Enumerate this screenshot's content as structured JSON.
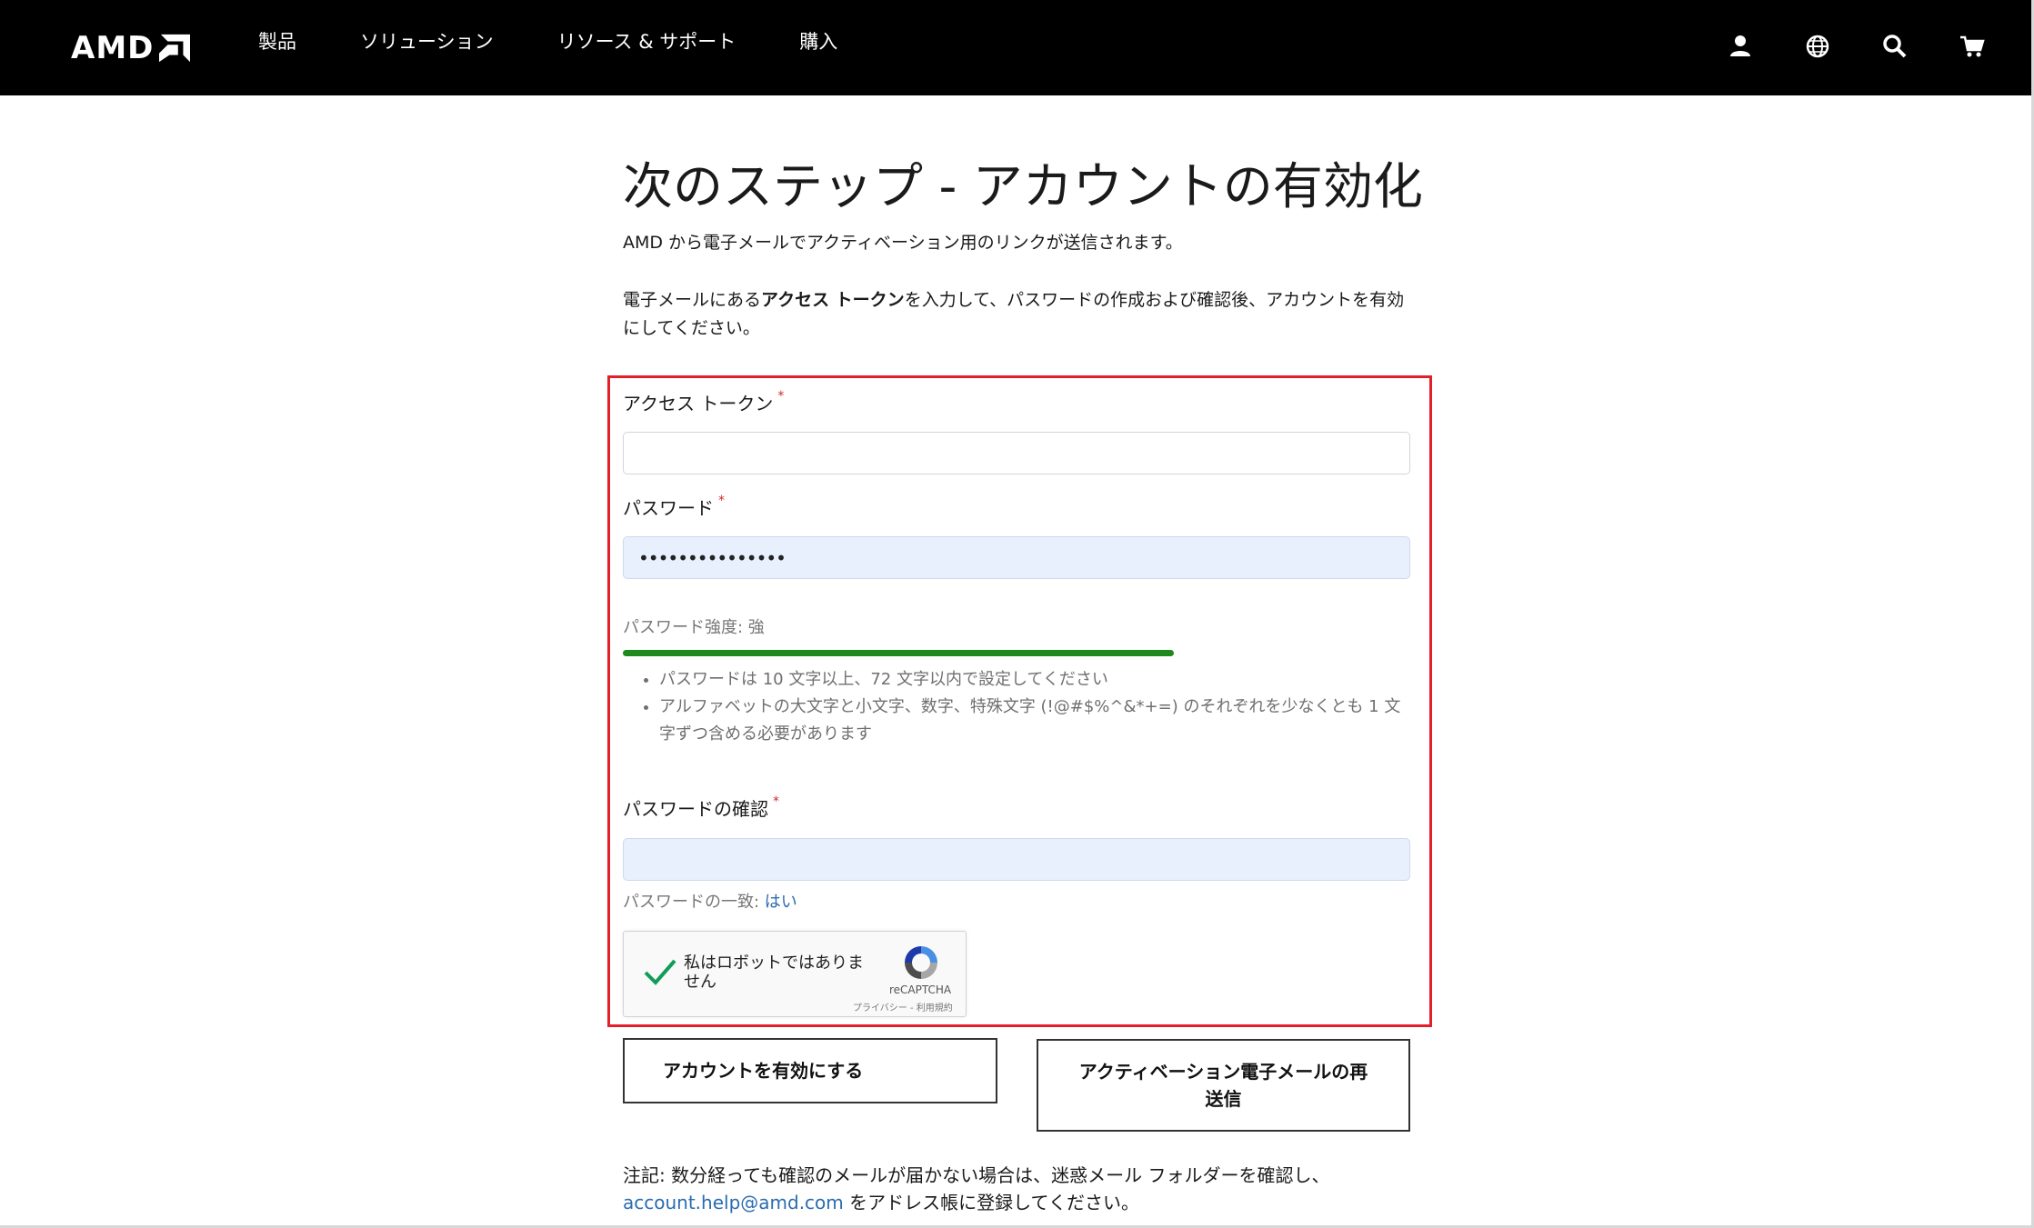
{
  "header": {
    "logo_text": "AMD",
    "nav": [
      "製品",
      "ソリューション",
      "リソース & サポート",
      "購入"
    ],
    "icons": [
      "user-icon",
      "globe-icon",
      "search-icon",
      "cart-icon"
    ]
  },
  "page": {
    "title": "次のステップ - アカウントの有効化",
    "intro": "AMD から電子メールでアクティベーション用のリンクが送信されます。",
    "instr_prefix": "電子メールにある",
    "instr_bold": "アクセス トークン",
    "instr_suffix": "を入力して、パスワードの作成および確認後、アカウントを有効にしてください。"
  },
  "form": {
    "token_label": "アクセス トークン",
    "token_value": "",
    "password_label": "パスワード",
    "password_value": "•••••••••••••••",
    "required_mark": "*",
    "strength_label": "パスワード強度: 強",
    "strength_fraction": 0.7,
    "strength_color": "#1e8a1e",
    "rules": [
      "パスワードは 10 文字以上、72 文字以内で設定してください",
      "アルファベットの大文字と小文字、数字、特殊文字 (!@#$%^&*+=) のそれぞれを少なくとも 1 文字ずつ含める必要があります"
    ],
    "confirm_label": "パスワードの確認",
    "confirm_value": "",
    "match_label": "パスワードの一致: ",
    "match_value": "はい"
  },
  "captcha": {
    "text": "私はロボットではありません",
    "brand": "reCAPTCHA",
    "terms": "プライバシー - 利用規約"
  },
  "buttons": {
    "activate": "アカウントを有効にする",
    "resend": "アクティベーション電子メールの再送信"
  },
  "note": {
    "prefix": "注記: 数分経っても確認のメールが届かない場合は、迷惑メール フォルダーを確認し、",
    "email": "account.help@amd.com",
    "suffix": " をアドレス帳に登録してください。"
  },
  "colors": {
    "header_bg": "#000000",
    "highlight_border": "#e3202a",
    "link": "#2b6cb0"
  }
}
